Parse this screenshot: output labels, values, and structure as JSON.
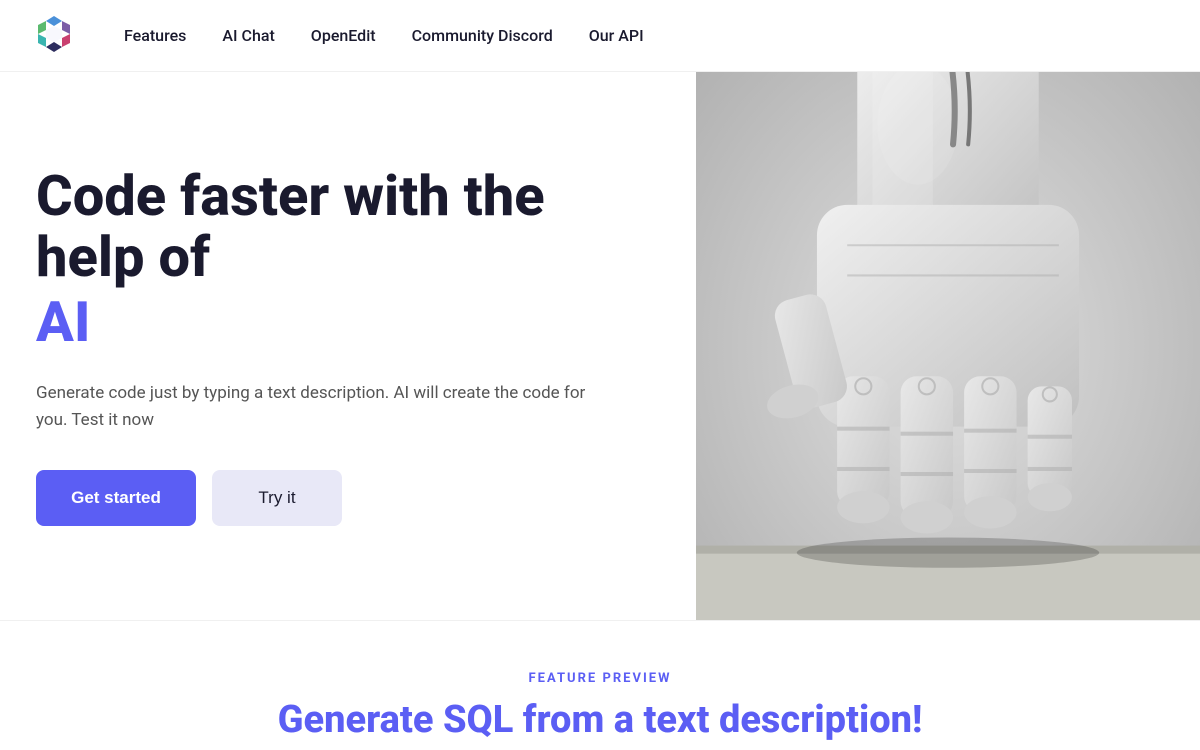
{
  "nav": {
    "logo_alt": "Logo",
    "links": [
      {
        "label": "Features",
        "href": "#"
      },
      {
        "label": "AI Chat",
        "href": "#"
      },
      {
        "label": "OpenEdit",
        "href": "#"
      },
      {
        "label": "Community Discord",
        "href": "#"
      },
      {
        "label": "Our API",
        "href": "#"
      }
    ]
  },
  "hero": {
    "title_line1": "Code faster with the",
    "title_line2": "help of",
    "title_ai": "AI",
    "description": "Generate code just by typing a text description. AI will create the code for you. Test it now",
    "btn_primary": "Get started",
    "btn_secondary": "Try it"
  },
  "feature_preview": {
    "label": "FEATURE PREVIEW",
    "title_prefix": "Generate ",
    "title_highlight": "SQL",
    "title_suffix": " from a text description!"
  },
  "colors": {
    "accent": "#5b5ef4",
    "dark": "#1a1a2e",
    "muted": "#555555"
  }
}
